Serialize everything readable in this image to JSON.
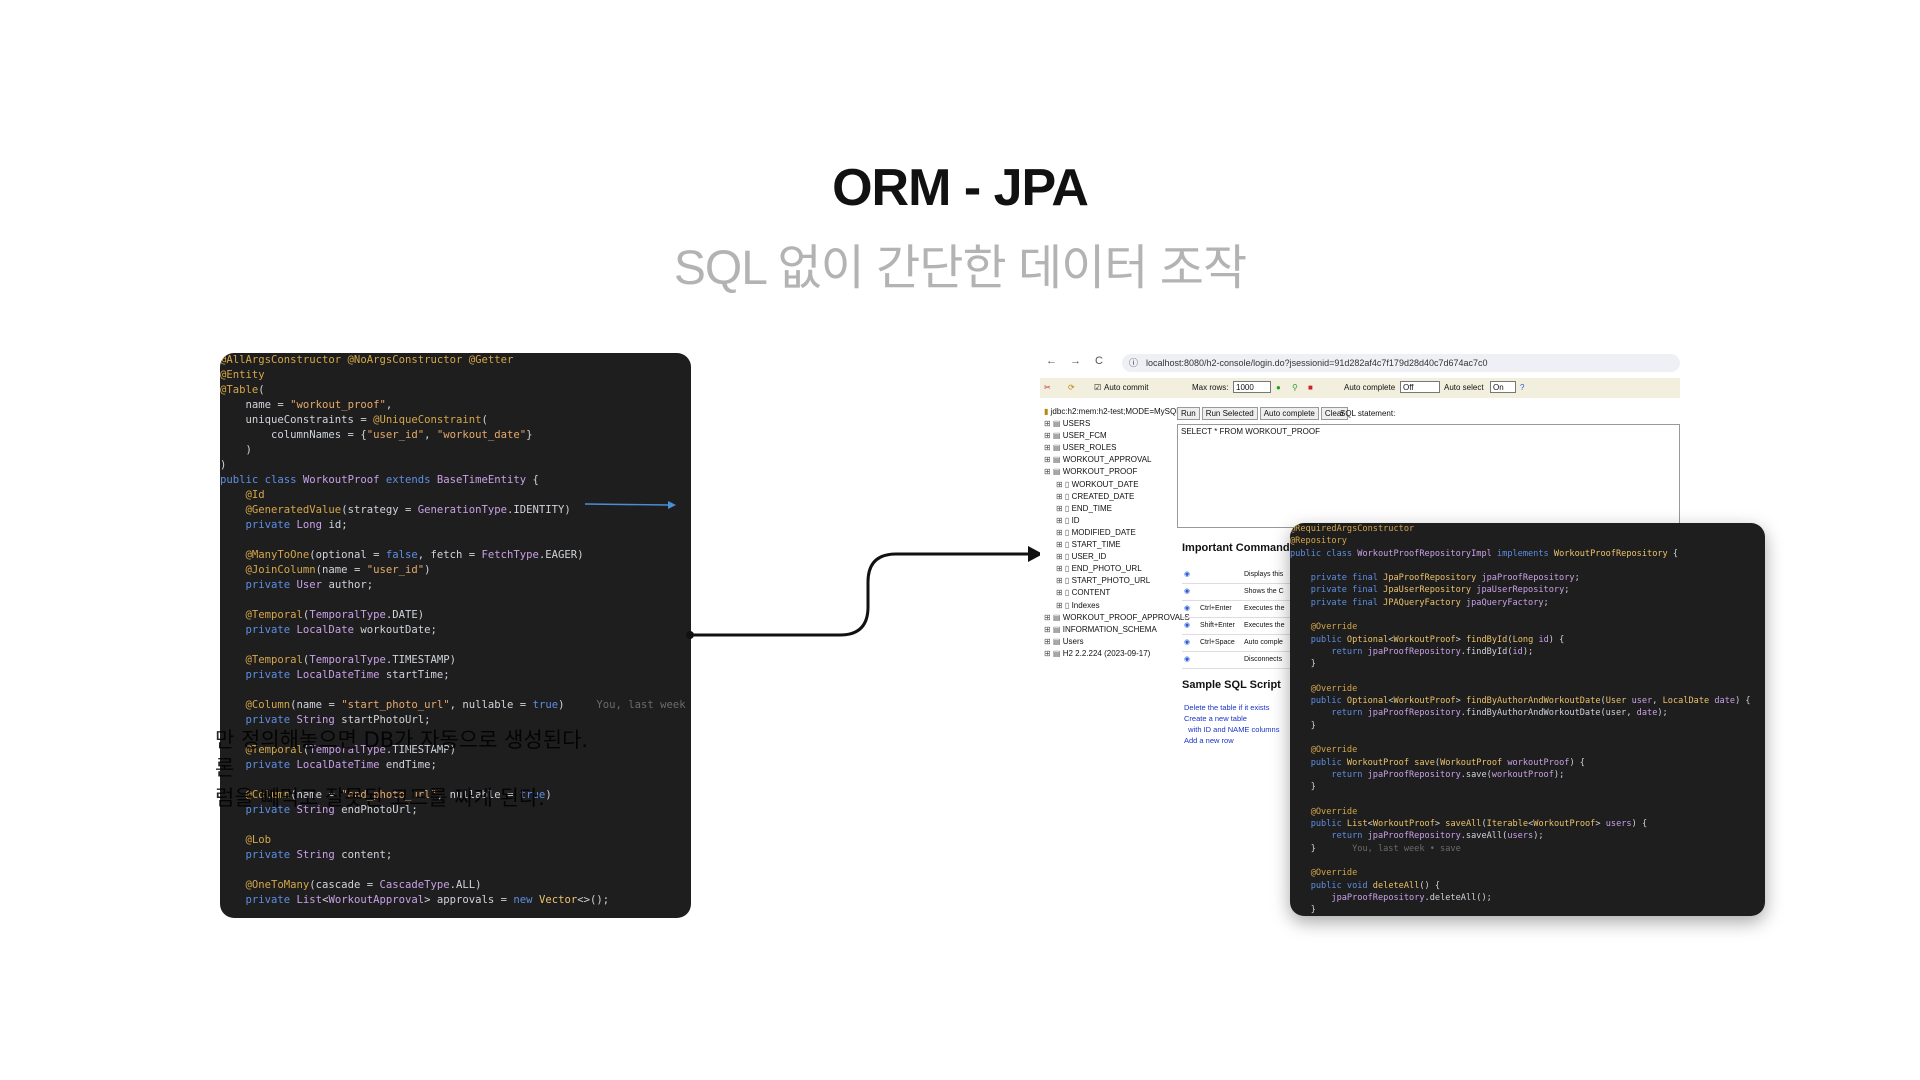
{
  "slide": {
    "title": "ORM - JPA",
    "subtitle": "SQL 없이 간단한 데이터 조작",
    "overlay_lines": [
      "만 정의해놓으면 DB가 자동으로 생성된다.",
      "론 ",
      "럼을 빼먹고 잘못된 코드를 짜게 된다."
    ]
  },
  "left_code": [
    [
      [
        "ann",
        "@AllArgsConstructor @NoArgsConstructor @Getter"
      ]
    ],
    [
      [
        "ann",
        "@Entity"
      ]
    ],
    [
      [
        "ann",
        "@Table"
      ],
      [
        "",
        "("
      ]
    ],
    [
      [
        "",
        "    name = "
      ],
      [
        "str",
        "\"workout_proof\""
      ],
      [
        "",
        ","
      ]
    ],
    [
      [
        "",
        "    uniqueConstraints = "
      ],
      [
        "ann",
        "@UniqueConstraint"
      ],
      [
        "",
        "("
      ]
    ],
    [
      [
        "",
        "        columnNames = {"
      ],
      [
        "str",
        "\"user_id\""
      ],
      [
        "",
        ", "
      ],
      [
        "str",
        "\"workout_date\""
      ],
      [
        "",
        "}"
      ]
    ],
    [
      [
        "",
        "    )"
      ]
    ],
    [
      [
        "",
        ")"
      ]
    ],
    [
      [
        "kw",
        "public class "
      ],
      [
        "cls",
        "WorkoutProof "
      ],
      [
        "kw",
        "extends "
      ],
      [
        "cls",
        "BaseTimeEntity "
      ],
      [
        "",
        "{"
      ]
    ],
    [
      [
        "ann",
        "    @Id"
      ]
    ],
    [
      [
        "ann",
        "    @GeneratedValue"
      ],
      [
        "",
        "(strategy = "
      ],
      [
        "cls",
        "GenerationType"
      ],
      [
        "",
        ".IDENTITY)"
      ]
    ],
    [
      [
        "kw",
        "    private "
      ],
      [
        "cls",
        "Long "
      ],
      [
        "",
        "id;"
      ]
    ],
    [
      [
        "",
        ""
      ]
    ],
    [
      [
        "ann",
        "    @ManyToOne"
      ],
      [
        "",
        "(optional = "
      ],
      [
        "kw",
        "false"
      ],
      [
        "",
        ", fetch = "
      ],
      [
        "cls",
        "FetchType"
      ],
      [
        "",
        ".EAGER)"
      ]
    ],
    [
      [
        "ann",
        "    @JoinColumn"
      ],
      [
        "",
        "(name = "
      ],
      [
        "str",
        "\"user_id\""
      ],
      [
        "",
        ")"
      ]
    ],
    [
      [
        "kw",
        "    private "
      ],
      [
        "cls",
        "User "
      ],
      [
        "",
        "author;"
      ]
    ],
    [
      [
        "",
        ""
      ]
    ],
    [
      [
        "ann",
        "    @Temporal"
      ],
      [
        "",
        "("
      ],
      [
        "cls",
        "TemporalType"
      ],
      [
        "",
        ".DATE)"
      ]
    ],
    [
      [
        "kw",
        "    private "
      ],
      [
        "cls",
        "LocalDate "
      ],
      [
        "",
        "workoutDate;"
      ]
    ],
    [
      [
        "",
        ""
      ]
    ],
    [
      [
        "ann",
        "    @Temporal"
      ],
      [
        "",
        "("
      ],
      [
        "cls",
        "TemporalType"
      ],
      [
        "",
        ".TIMESTAMP)"
      ]
    ],
    [
      [
        "kw",
        "    private "
      ],
      [
        "cls",
        "LocalDateTime "
      ],
      [
        "",
        "startTime;"
      ]
    ],
    [
      [
        "",
        ""
      ]
    ],
    [
      [
        "ann",
        "    @Column"
      ],
      [
        "",
        "(name = "
      ],
      [
        "str",
        "\"start_photo_url\""
      ],
      [
        "",
        ", nullable = "
      ],
      [
        "kw",
        "true"
      ],
      [
        "",
        ")     "
      ],
      [
        "com",
        "You, last week •"
      ]
    ],
    [
      [
        "kw",
        "    private "
      ],
      [
        "cls",
        "String "
      ],
      [
        "",
        "startPhotoUrl;"
      ]
    ],
    [
      [
        "",
        ""
      ]
    ],
    [
      [
        "ann",
        "    @Temporal"
      ],
      [
        "",
        "("
      ],
      [
        "cls",
        "TemporalType"
      ],
      [
        "",
        ".TIMESTAMP)"
      ]
    ],
    [
      [
        "kw",
        "    private "
      ],
      [
        "cls",
        "LocalDateTime "
      ],
      [
        "",
        "endTime;"
      ]
    ],
    [
      [
        "",
        ""
      ]
    ],
    [
      [
        "ann",
        "    @Column"
      ],
      [
        "",
        "(name = "
      ],
      [
        "str",
        "\"end_photo_url\""
      ],
      [
        "",
        ", nullable = "
      ],
      [
        "kw",
        "true"
      ],
      [
        "",
        ")"
      ]
    ],
    [
      [
        "kw",
        "    private "
      ],
      [
        "cls",
        "String "
      ],
      [
        "",
        "endPhotoUrl;"
      ]
    ],
    [
      [
        "",
        ""
      ]
    ],
    [
      [
        "ann",
        "    @Lob"
      ]
    ],
    [
      [
        "kw",
        "    private "
      ],
      [
        "cls",
        "String "
      ],
      [
        "",
        "content;"
      ]
    ],
    [
      [
        "",
        ""
      ]
    ],
    [
      [
        "ann",
        "    @OneToMany"
      ],
      [
        "",
        "(cascade = "
      ],
      [
        "cls",
        "CascadeType"
      ],
      [
        "",
        ".ALL)"
      ]
    ],
    [
      [
        "kw",
        "    private "
      ],
      [
        "cls",
        "List"
      ],
      [
        "",
        "<"
      ],
      [
        "cls",
        "WorkoutApproval"
      ],
      [
        "",
        "> approvals = "
      ],
      [
        "kw",
        "new "
      ],
      [
        "fn",
        "Vector"
      ],
      [
        "",
        "<>();"
      ]
    ]
  ],
  "right_code": [
    [
      [
        "ann",
        "@RequiredArgsConstructor"
      ]
    ],
    [
      [
        "ann",
        "@Repository"
      ]
    ],
    [
      [
        "kw",
        "public class "
      ],
      [
        "cls",
        "WorkoutProofRepositoryImpl "
      ],
      [
        "kw",
        "implements "
      ],
      [
        "fn",
        "WorkoutProofRepository "
      ],
      [
        "",
        "{"
      ]
    ],
    [
      [
        "",
        ""
      ]
    ],
    [
      [
        "kw",
        "    private final "
      ],
      [
        "fn",
        "JpaProofRepository "
      ],
      [
        "cls",
        "jpaProofRepository"
      ],
      [
        "",
        ";"
      ]
    ],
    [
      [
        "kw",
        "    private final "
      ],
      [
        "fn",
        "JpaUserRepository "
      ],
      [
        "cls",
        "jpaUserRepository"
      ],
      [
        "",
        ";"
      ]
    ],
    [
      [
        "kw",
        "    private final "
      ],
      [
        "fn",
        "JPAQueryFactory "
      ],
      [
        "cls",
        "jpaQueryFactory"
      ],
      [
        "",
        ";"
      ]
    ],
    [
      [
        "",
        ""
      ]
    ],
    [
      [
        "ann",
        "    @Override"
      ]
    ],
    [
      [
        "kw",
        "    public "
      ],
      [
        "fn",
        "Optional"
      ],
      [
        "",
        "<"
      ],
      [
        "fn",
        "WorkoutProof"
      ],
      [
        "",
        "> "
      ],
      [
        "fn",
        "findById"
      ],
      [
        "",
        "("
      ],
      [
        "fn",
        "Long "
      ],
      [
        "cls",
        "id"
      ],
      [
        "",
        ") {"
      ]
    ],
    [
      [
        "kw",
        "        return "
      ],
      [
        "cls",
        "jpaProofRepository"
      ],
      [
        "",
        ".findById("
      ],
      [
        "cls",
        "id"
      ],
      [
        "",
        ");"
      ]
    ],
    [
      [
        "",
        "    }"
      ]
    ],
    [
      [
        "",
        ""
      ]
    ],
    [
      [
        "ann",
        "    @Override"
      ]
    ],
    [
      [
        "kw",
        "    public "
      ],
      [
        "fn",
        "Optional"
      ],
      [
        "",
        "<"
      ],
      [
        "fn",
        "WorkoutProof"
      ],
      [
        "",
        "> "
      ],
      [
        "fn",
        "findByAuthorAndWorkoutDate"
      ],
      [
        "",
        "("
      ],
      [
        "fn",
        "User "
      ],
      [
        "cls",
        "user"
      ],
      [
        "",
        ", "
      ],
      [
        "fn",
        "LocalDate "
      ],
      [
        "cls",
        "date"
      ],
      [
        "",
        ") {"
      ]
    ],
    [
      [
        "kw",
        "        return "
      ],
      [
        "cls",
        "jpaProofRepository"
      ],
      [
        "",
        ".findByAuthorAndWorkoutDate(user, "
      ],
      [
        "cls",
        "date"
      ],
      [
        "",
        ");"
      ]
    ],
    [
      [
        "",
        "    }"
      ]
    ],
    [
      [
        "",
        ""
      ]
    ],
    [
      [
        "ann",
        "    @Override"
      ]
    ],
    [
      [
        "kw",
        "    public "
      ],
      [
        "fn",
        "WorkoutProof "
      ],
      [
        "fn",
        "save"
      ],
      [
        "",
        "("
      ],
      [
        "fn",
        "WorkoutProof "
      ],
      [
        "cls",
        "workoutProof"
      ],
      [
        "",
        ") {"
      ]
    ],
    [
      [
        "kw",
        "        return "
      ],
      [
        "cls",
        "jpaProofRepository"
      ],
      [
        "",
        ".save("
      ],
      [
        "cls",
        "workoutProof"
      ],
      [
        "",
        ");"
      ]
    ],
    [
      [
        "",
        "    }"
      ]
    ],
    [
      [
        "",
        ""
      ]
    ],
    [
      [
        "ann",
        "    @Override"
      ]
    ],
    [
      [
        "kw",
        "    public "
      ],
      [
        "fn",
        "List"
      ],
      [
        "",
        "<"
      ],
      [
        "fn",
        "WorkoutProof"
      ],
      [
        "",
        "> "
      ],
      [
        "fn",
        "saveAll"
      ],
      [
        "",
        "("
      ],
      [
        "fn",
        "Iterable"
      ],
      [
        "",
        "<"
      ],
      [
        "fn",
        "WorkoutProof"
      ],
      [
        "",
        "> "
      ],
      [
        "cls",
        "users"
      ],
      [
        "",
        ") {"
      ]
    ],
    [
      [
        "kw",
        "        return "
      ],
      [
        "cls",
        "jpaProofRepository"
      ],
      [
        "",
        ".saveAll("
      ],
      [
        "cls",
        "users"
      ],
      [
        "",
        ");"
      ]
    ],
    [
      [
        "",
        "    }       "
      ],
      [
        "com",
        "You, last week • save"
      ]
    ],
    [
      [
        "",
        ""
      ]
    ],
    [
      [
        "ann",
        "    @Override"
      ]
    ],
    [
      [
        "kw",
        "    public void "
      ],
      [
        "fn",
        "deleteAll"
      ],
      [
        "",
        "() {"
      ]
    ],
    [
      [
        "",
        "        "
      ],
      [
        "cls",
        "jpaProofRepository"
      ],
      [
        "",
        ".deleteAll();"
      ]
    ],
    [
      [
        "",
        "    }"
      ]
    ]
  ],
  "browser": {
    "url": "localhost:8080/h2-console/login.do?jsessionid=91d282af4c7f179d28d40c7d674ac7c0",
    "back": "←",
    "forward": "→",
    "reload": "C"
  },
  "h2": {
    "auto_commit_label": "Auto commit",
    "max_rows_label": "Max rows:",
    "max_rows_value": "1000",
    "auto_complete_label": "Auto complete",
    "auto_complete_value": "Off",
    "auto_select_label": "Auto select",
    "auto_select_value": "On",
    "connection": "jdbc:h2:mem:h2-test;MODE=MySQL",
    "tree": [
      {
        "label": "USERS",
        "indent": 0
      },
      {
        "label": "USER_FCM",
        "indent": 0
      },
      {
        "label": "USER_ROLES",
        "indent": 0
      },
      {
        "label": "WORKOUT_APPROVAL",
        "indent": 0
      },
      {
        "label": "WORKOUT_PROOF",
        "indent": 0
      },
      {
        "label": "WORKOUT_DATE",
        "indent": 1
      },
      {
        "label": "CREATED_DATE",
        "indent": 1
      },
      {
        "label": "END_TIME",
        "indent": 1
      },
      {
        "label": "ID",
        "indent": 1
      },
      {
        "label": "MODIFIED_DATE",
        "indent": 1
      },
      {
        "label": "START_TIME",
        "indent": 1
      },
      {
        "label": "USER_ID",
        "indent": 1
      },
      {
        "label": "END_PHOTO_URL",
        "indent": 1
      },
      {
        "label": "START_PHOTO_URL",
        "indent": 1
      },
      {
        "label": "CONTENT",
        "indent": 1
      },
      {
        "label": "Indexes",
        "indent": 1
      },
      {
        "label": "WORKOUT_PROOF_APPROVALS",
        "indent": 0
      },
      {
        "label": "INFORMATION_SCHEMA",
        "indent": 0
      },
      {
        "label": "Users",
        "indent": 0
      },
      {
        "label": "H2 2.2.224 (2023-09-17)",
        "indent": 0
      }
    ],
    "buttons": [
      "Run",
      "Run Selected",
      "Auto complete",
      "Clear"
    ],
    "sql_label": "SQL statement:",
    "sql": "SELECT * FROM WORKOUT_PROOF",
    "important_title": "Important Commands",
    "commands": [
      {
        "key": "",
        "desc": "Displays this"
      },
      {
        "key": "",
        "desc": "Shows the C"
      },
      {
        "key": "Ctrl+Enter",
        "desc": "Executes the"
      },
      {
        "key": "Shift+Enter",
        "desc": "Executes the"
      },
      {
        "key": "Ctrl+Space",
        "desc": "Auto comple"
      },
      {
        "key": "",
        "desc": "Disconnects"
      }
    ],
    "sample_title": "Sample SQL Script",
    "sample_links": [
      "Delete the table if it exists",
      "Create a new table",
      "  with ID and NAME columns",
      "Add a new row"
    ]
  }
}
